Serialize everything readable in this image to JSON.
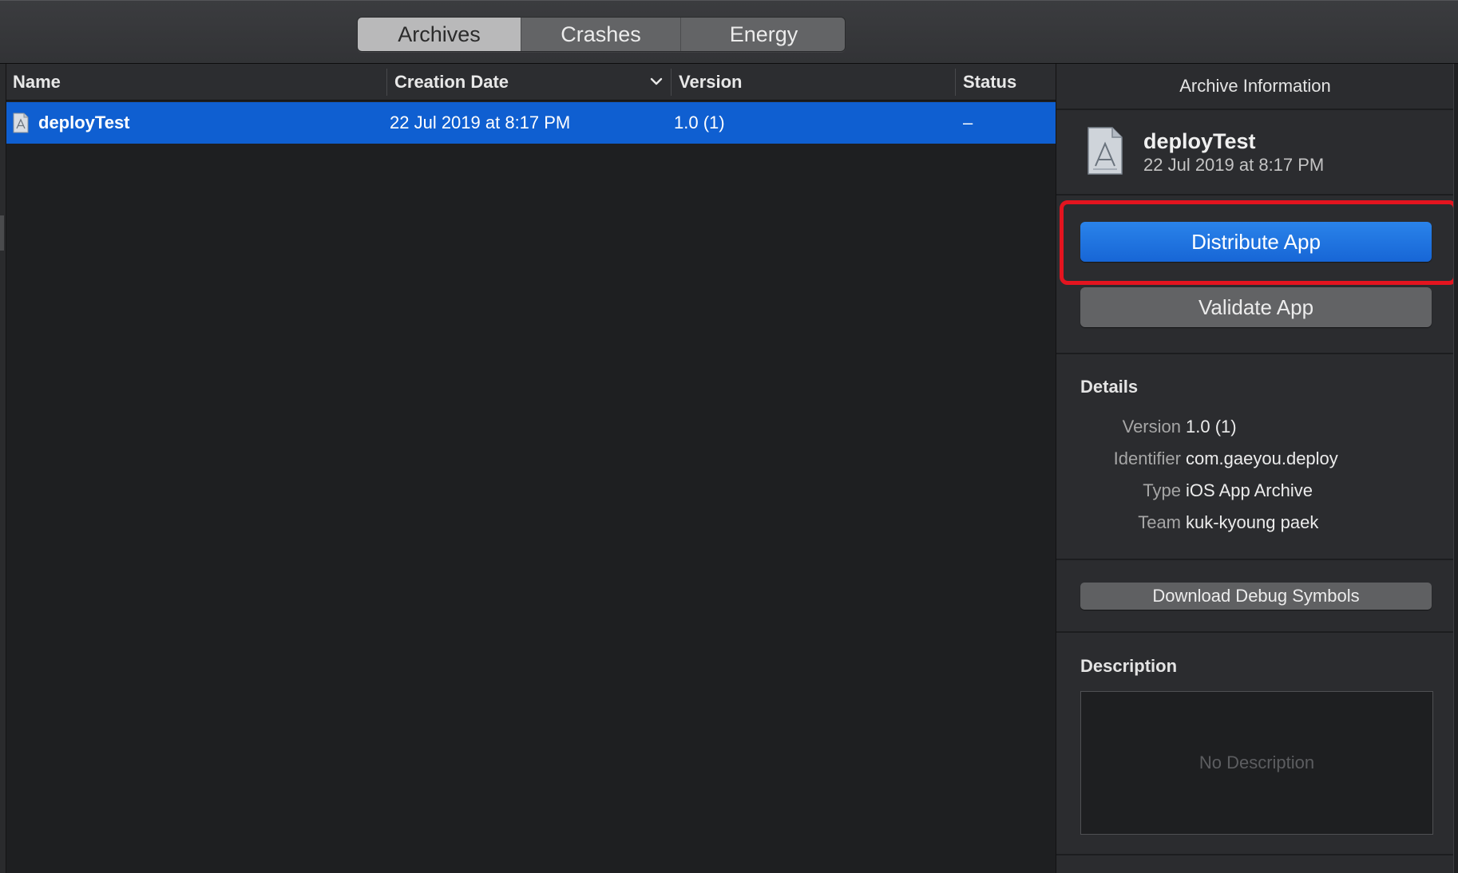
{
  "toolbar": {
    "tabs": [
      {
        "label": "Archives",
        "selected": true
      },
      {
        "label": "Crashes",
        "selected": false
      },
      {
        "label": "Energy",
        "selected": false
      }
    ]
  },
  "table": {
    "columns": [
      "Name",
      "Creation Date",
      "Version",
      "Status"
    ],
    "sorted_column": "Creation Date",
    "rows": [
      {
        "name": "deployTest",
        "creation_date": "22 Jul 2019 at 8:17 PM",
        "version": "1.0 (1)",
        "status": "–",
        "selected": true
      }
    ]
  },
  "inspector": {
    "title": "Archive Information",
    "archive_name": "deployTest",
    "archive_date": "22 Jul 2019 at 8:17 PM",
    "distribute_label": "Distribute App",
    "validate_label": "Validate App",
    "details_heading": "Details",
    "details": [
      {
        "label": "Version",
        "value": "1.0 (1)"
      },
      {
        "label": "Identifier",
        "value": "com.gaeyou.deploy"
      },
      {
        "label": "Type",
        "value": "iOS App Archive"
      },
      {
        "label": "Team",
        "value": "kuk-kyoung paek"
      }
    ],
    "debug_symbols_label": "Download Debug Symbols",
    "description_heading": "Description",
    "description_placeholder": "No Description"
  },
  "colors": {
    "accent": "#1766d6",
    "selection": "#0f5fd1",
    "highlight": "#e3141f"
  },
  "icons": [
    "app-archive-doc-icon",
    "sort-chevron-down-icon"
  ]
}
